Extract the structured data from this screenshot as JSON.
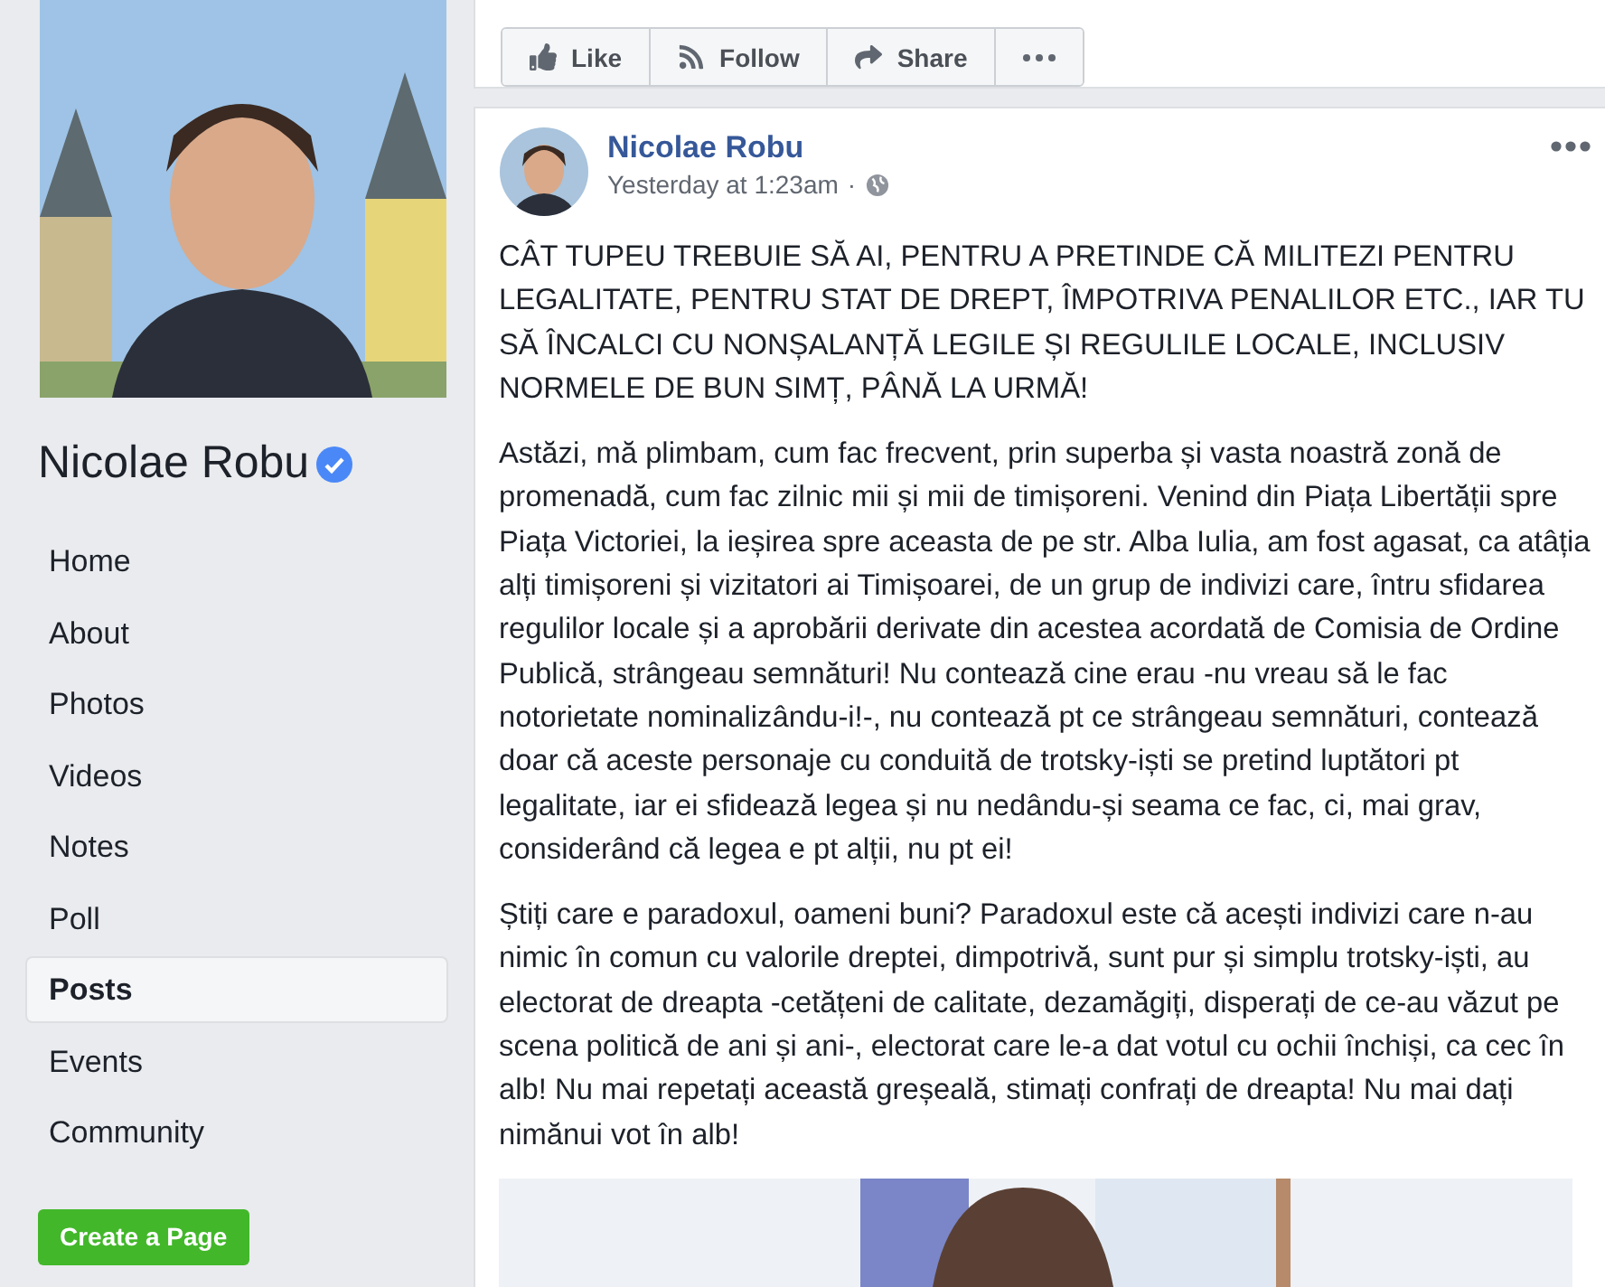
{
  "page": {
    "name": "Nicolae Robu",
    "verified": true
  },
  "nav": [
    {
      "label": "Home",
      "selected": false
    },
    {
      "label": "About",
      "selected": false
    },
    {
      "label": "Photos",
      "selected": false
    },
    {
      "label": "Videos",
      "selected": false
    },
    {
      "label": "Notes",
      "selected": false
    },
    {
      "label": "Poll",
      "selected": false
    },
    {
      "label": "Posts",
      "selected": true
    },
    {
      "label": "Events",
      "selected": false
    },
    {
      "label": "Community",
      "selected": false
    }
  ],
  "create_button": "Create a Page",
  "actions": [
    {
      "kind": "like",
      "label": "Like"
    },
    {
      "kind": "follow",
      "label": "Follow"
    },
    {
      "kind": "share",
      "label": "Share"
    },
    {
      "kind": "more"
    }
  ],
  "post": {
    "author": "Nicolae Robu",
    "time": "Yesterday at 1:23am",
    "separator": "·",
    "paragraphs": [
      "CÂT TUPEU TREBUIE SĂ AI, PENTRU A PRETINDE CĂ MILITEZI PENTRU LEGALITATE, PENTRU STAT DE DREPT, ÎMPOTRIVA PENALILOR ETC., IAR TU SĂ ÎNCALCI CU NONȘALANȚĂ LEGILE ȘI REGULILE LOCALE, INCLUSIV NORMELE DE BUN SIMȚ, PÂNĂ LA URMĂ!",
      "Astăzi, mă plimbam, cum fac frecvent, prin superba și vasta noastră zonă de promenadă, cum fac zilnic mii și mii de timișoreni. Venind din Piața Libertății spre Piața Victoriei, la ieșirea spre aceasta de pe str. Alba Iulia, am fost agasat, ca atâția alți timișoreni și vizitatori ai Timișoarei, de un grup de indivizi care, întru sfidarea regulilor locale și a aprobării derivate din acestea acordată de Comisia de Ordine Publică, strângeau semnături! Nu contează cine erau -nu vreau să le fac notorietate nominalizându-i!-, nu contează pt ce strângeau semnături, contează doar că aceste personaje cu conduită de trotsky-iști se pretind luptători pt legalitate, iar ei sfidează legea și nu nedându-și seama ce fac, ci, mai grav, considerând că legea e pt alții, nu pt ei!",
      "Știți care e paradoxul, oameni buni? Paradoxul este că acești indivizi care n-au nimic în comun cu valorile dreptei, dimpotrivă, sunt pur și simplu trotsky-iști, au electorat de dreapta -cetățeni de calitate, dezamăgiți, disperați de ce-au văzut pe scena politică de ani și ani-, electorat care le-a dat votul cu ochii închiși, ca cec în alb! Nu mai repetați această greșeală, stimați confrați de dreapta! Nu mai dați nimănui vot în alb!"
    ]
  }
}
